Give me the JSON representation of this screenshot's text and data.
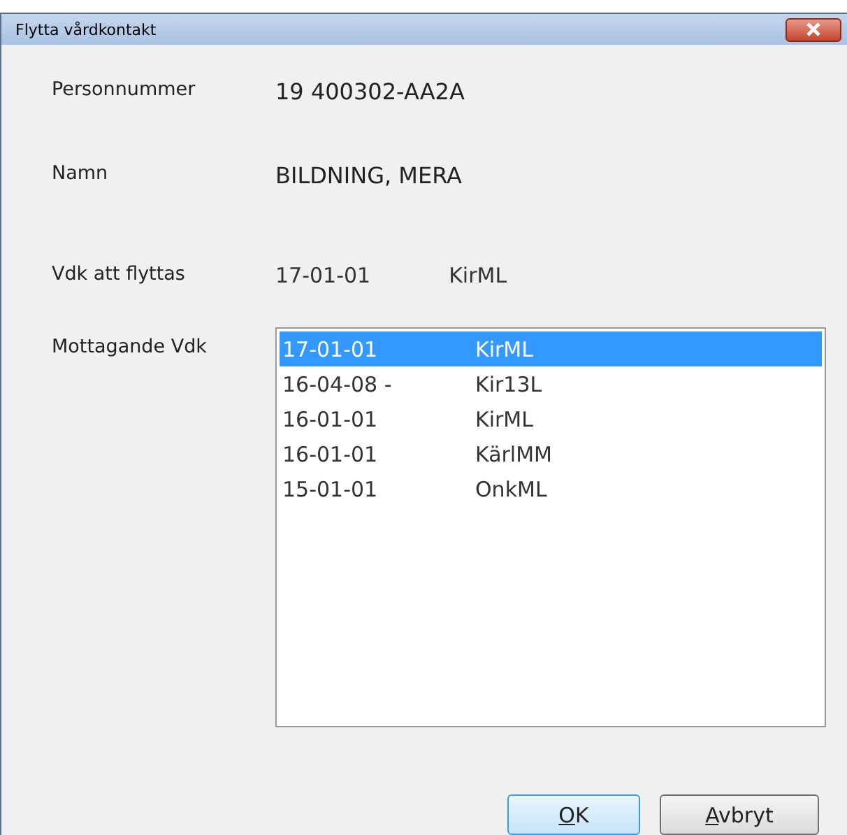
{
  "window": {
    "title": "Flytta vårdkontakt"
  },
  "fields": [
    {
      "label": "Personnummer",
      "value": "19 400302-AA2A"
    },
    {
      "label": "Namn",
      "value": "BILDNING, MERA"
    }
  ],
  "source": {
    "label": "Vdk att flyttas",
    "date": "17-01-01",
    "unit": "KirML"
  },
  "target": {
    "label": "Mottagande Vdk",
    "items": [
      {
        "date": "17-01-01",
        "unit": "KirML",
        "selected": true
      },
      {
        "date": "16-04-08 -",
        "unit": "Kir13L",
        "selected": false
      },
      {
        "date": "16-01-01",
        "unit": "KirML",
        "selected": false
      },
      {
        "date": "16-01-01",
        "unit": "KärlMM",
        "selected": false
      },
      {
        "date": "15-01-01",
        "unit": "OnkML",
        "selected": false
      }
    ]
  },
  "buttons": [
    {
      "mnemonic": "O",
      "rest": "K",
      "default": true
    },
    {
      "mnemonic": "A",
      "rest": "vbryt",
      "default": false
    }
  ]
}
